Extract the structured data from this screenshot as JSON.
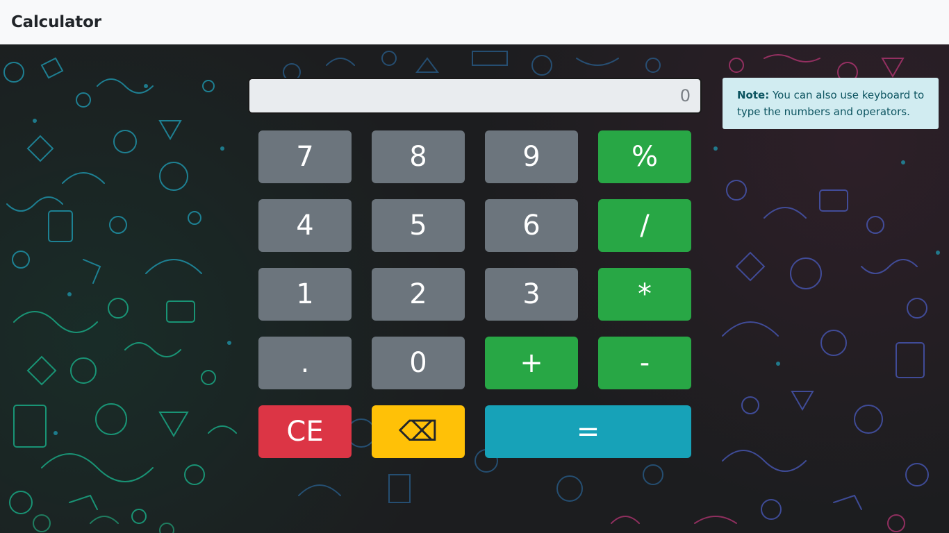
{
  "navbar": {
    "brand": "Calculator"
  },
  "display": {
    "value": "0"
  },
  "note": {
    "label": "Note:",
    "text": " You can also use keyboard to type the numbers and operators."
  },
  "keys": {
    "seven": "7",
    "eight": "8",
    "nine": "9",
    "percent": "%",
    "four": "4",
    "five": "5",
    "six": "6",
    "divide": "/",
    "one": "1",
    "two": "2",
    "three": "3",
    "multiply": "*",
    "dot": ".",
    "zero": "0",
    "plus": "+",
    "minus": "-",
    "clear": "CE",
    "backspace": "⌫",
    "equals": "="
  },
  "colors": {
    "number_key": "#6c757d",
    "operator_key": "#28a745",
    "clear_key": "#dc3545",
    "backspace_key": "#ffc107",
    "equals_key": "#17a2b8",
    "note_bg": "#d1ecf1",
    "note_text": "#0c5460"
  }
}
